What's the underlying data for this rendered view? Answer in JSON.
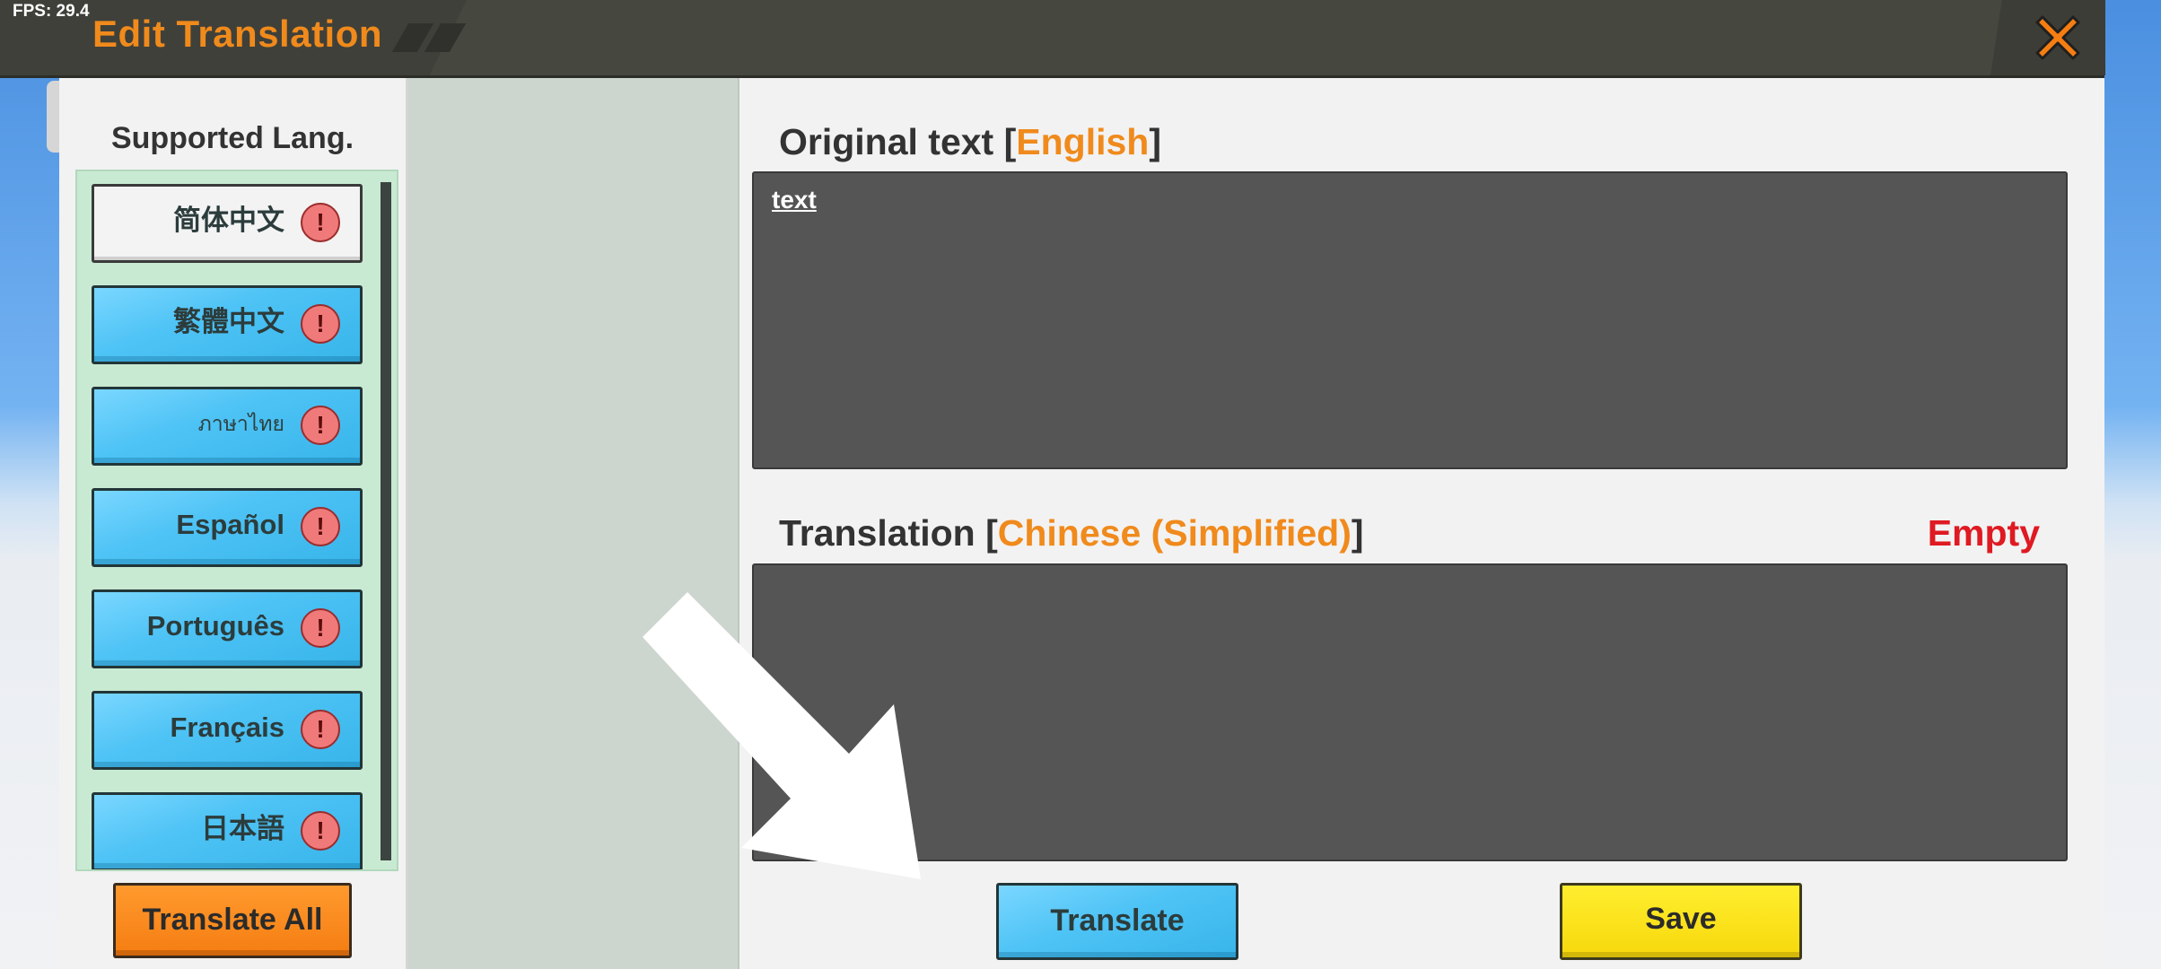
{
  "fps": "FPS: 29.4",
  "window": {
    "title": "Edit Translation"
  },
  "sidebar": {
    "title": "Supported Lang.",
    "languages": [
      {
        "label": "简体中文",
        "selected": true,
        "status": "warning"
      },
      {
        "label": "繁體中文",
        "selected": false,
        "status": "warning"
      },
      {
        "label": "ภาษาไทย",
        "selected": false,
        "status": "warning"
      },
      {
        "label": "Español",
        "selected": false,
        "status": "warning"
      },
      {
        "label": "Português",
        "selected": false,
        "status": "warning"
      },
      {
        "label": "Français",
        "selected": false,
        "status": "warning"
      },
      {
        "label": "日本語",
        "selected": false,
        "status": "warning"
      }
    ],
    "warning_glyph": "!",
    "translate_all_label": "Translate All"
  },
  "original": {
    "title_prefix": "Original text [",
    "language": "English",
    "title_suffix": "]",
    "text": "text"
  },
  "translation": {
    "title_prefix": "Translation [",
    "language": "Chinese (Simplified)",
    "title_suffix": "]",
    "status": "Empty",
    "text": ""
  },
  "actions": {
    "translate_label": "Translate",
    "save_label": "Save"
  },
  "colors": {
    "accent_orange": "#f08a1c",
    "status_red": "#df1a22",
    "button_blue": "#4ec3f5",
    "button_yellow": "#f7d80c",
    "button_orange": "#f57d12"
  },
  "icons": {
    "close": "close-x-icon",
    "warning": "warning-icon",
    "hint_arrow": "arrow-pointer-icon"
  }
}
